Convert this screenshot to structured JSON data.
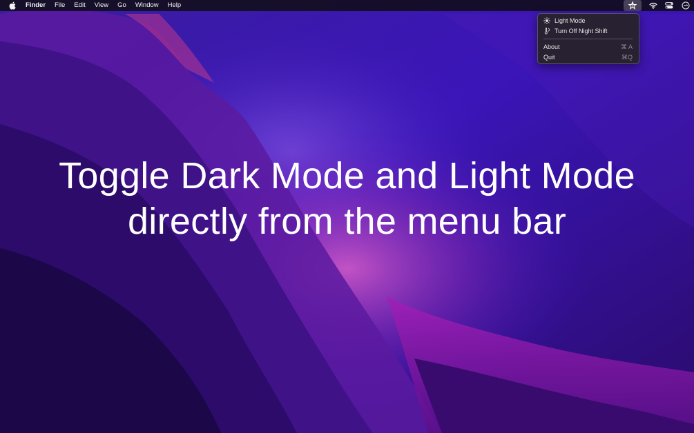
{
  "menubar": {
    "app_name": "Finder",
    "items": [
      "File",
      "Edit",
      "View",
      "Go",
      "Window",
      "Help"
    ],
    "status_icons": [
      "night-mode-star-icon",
      "wifi-icon",
      "control-center-icon",
      "siri-icon"
    ]
  },
  "dropdown": {
    "items": [
      {
        "icon": "sun-icon",
        "label": "Light Mode",
        "shortcut": ""
      },
      {
        "icon": "night-shift-icon",
        "label": "Turn Off Night Shift",
        "shortcut": ""
      },
      {
        "icon": "",
        "label": "About",
        "shortcut": "⌘ A"
      },
      {
        "icon": "",
        "label": "Quit",
        "shortcut": "⌘Q"
      }
    ]
  },
  "headline": {
    "line1": "Toggle Dark Mode and Light Mode",
    "line2": "directly from the menu bar"
  },
  "colors": {
    "wallpaper_base": "#2a0f6e",
    "wallpaper_accent": "#9b1fb0",
    "menubar_bg": "#120e1e",
    "text": "#ffffff"
  }
}
